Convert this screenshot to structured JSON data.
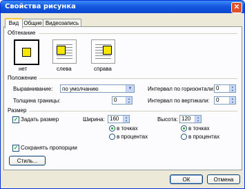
{
  "window": {
    "title": "Свойства рисунка",
    "close_glyph": "✕"
  },
  "tabs": [
    "Вид",
    "Общие",
    "Видеозапись"
  ],
  "wrap": {
    "title": "Обтекание",
    "options": [
      "нет",
      "слева",
      "справа"
    ]
  },
  "position": {
    "title": "Положение",
    "align_label": "Выравнивание:",
    "align_value": "по умолчанию",
    "border_label": "Толщина границы:",
    "border_value": "0",
    "hgap_label": "Интервал по горизонтали:",
    "hgap_value": "0",
    "vgap_label": "Интервал по вертикали:",
    "vgap_value": "0"
  },
  "size": {
    "title": "Размер",
    "set_size_label": "Задать размер",
    "width_label": "Ширина:",
    "width_value": "160",
    "height_label": "Высота:",
    "height_value": "120",
    "unit_points": "в точках",
    "unit_percent": "в процентах",
    "keep_ratio_label": "Сохранять пропорции"
  },
  "style_button": "Стиль...",
  "ok_button": "ОК",
  "cancel_button": "Отмена"
}
